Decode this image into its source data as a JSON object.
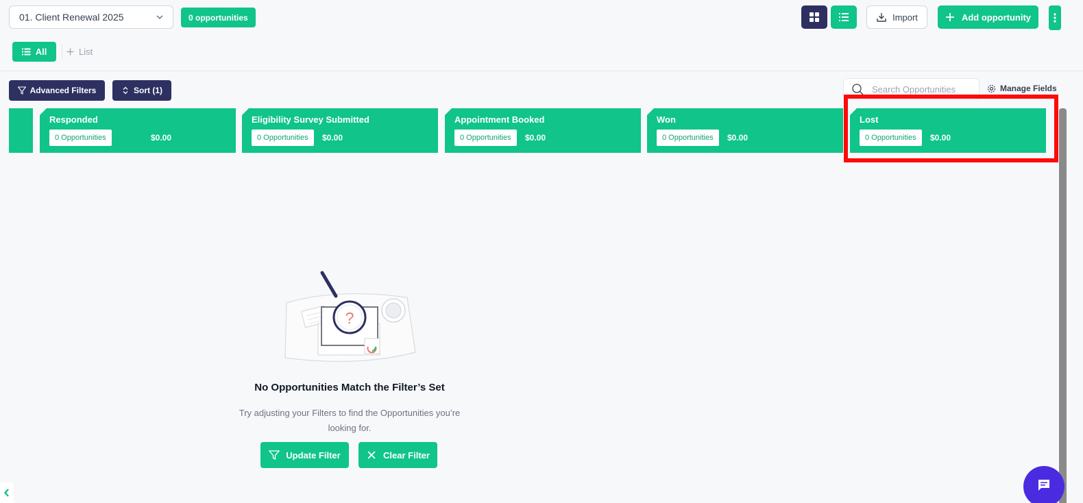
{
  "header": {
    "pipeline_select": "01. Client Renewal 2025",
    "opportunities_badge": "0 opportunities",
    "import_label": "Import",
    "add_label": "Add opportunity"
  },
  "tabs": {
    "all_label": "All",
    "add_list_label": "List"
  },
  "toolbar": {
    "advanced_filters_label": "Advanced Filters",
    "sort_label": "Sort (1)",
    "search_placeholder": "Search Opportunities",
    "manage_fields_label": "Manage Fields"
  },
  "stages": [
    {
      "name": "Responded",
      "count": "0 Opportunities",
      "amount": "$0.00"
    },
    {
      "name": "Eligibility Survey Submitted",
      "count": "0 Opportunities",
      "amount": "$0.00"
    },
    {
      "name": "Appointment Booked",
      "count": "0 Opportunities",
      "amount": "$0.00"
    },
    {
      "name": "Won",
      "count": "0 Opportunities",
      "amount": "$0.00"
    },
    {
      "name": "Lost",
      "count": "0 Opportunities",
      "amount": "$0.00"
    }
  ],
  "empty_state": {
    "title": "No Opportunities Match the Filter’s Set",
    "text_line1": "Try adjusting your Filters to find the Opportunities you’re",
    "text_line2": "looking for.",
    "update_filter_label": "Update Filter",
    "clear_filter_label": "Clear Filter"
  },
  "colors": {
    "accent_green": "#10c48a",
    "navy": "#2d3060",
    "highlight_red": "#ff0a0a",
    "chat_purple": "#4b2be0"
  },
  "icons": [
    "chevron-down-icon",
    "board-view-icon",
    "list-view-icon",
    "import-icon",
    "plus-icon",
    "kebab-icon",
    "list-icon",
    "filter-icon",
    "sort-icon",
    "search-icon",
    "gear-icon",
    "magnifier-illustration",
    "close-icon",
    "chat-icon",
    "chevron-left-icon"
  ]
}
